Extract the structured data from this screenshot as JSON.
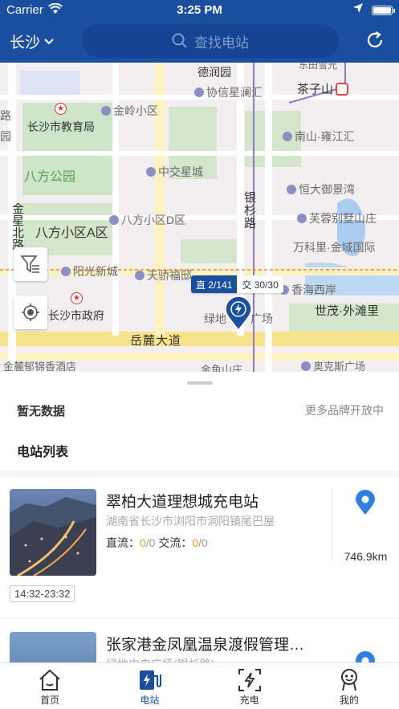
{
  "status_bar": {
    "carrier": "Carrier",
    "time": "3:25 PM"
  },
  "nav": {
    "city": "长沙",
    "search_placeholder": "查找电站"
  },
  "map": {
    "pois": [
      "德润园",
      "茶子山",
      "协信星澜汇",
      "金岭小区",
      "长沙市教育局",
      "南山·雍江汇",
      "八方公园",
      "中交星城",
      "恒大御景湾",
      "八方小区A区",
      "八方小区D区",
      "芙蓉别墅山庄",
      "万科里·金域国际",
      "阳光新城",
      "天骄福邸",
      "香海西岸",
      "长沙市政府",
      "世茂·外滩里",
      "岳麓大道",
      "金麓郁锦香酒店",
      "奥克斯广场",
      "银杉路",
      "绿地",
      "广场",
      "金星北路",
      "路",
      "园",
      "金鱼山庄",
      "东田雪光"
    ],
    "callout": {
      "dc": "直 2/141",
      "ac": "交 30/30"
    }
  },
  "sheet": {
    "no_data": "暂无数据",
    "more_brands": "更多品牌开放中",
    "list_title": "电站列表",
    "stations": [
      {
        "name": "翠柏大道理想城充电站",
        "address": "湖南省长沙市浏阳市洞阳镇尾巴屋",
        "dc_label": "直流：",
        "dc_avail": "0",
        "dc_total": "/0",
        "ac_label": "交流：",
        "ac_avail": "0",
        "ac_total": "/0",
        "distance": "746.9km",
        "hours": "14:32-23:32"
      },
      {
        "name": "张家港金凤凰温泉渡假管理…",
        "address": "绿地中央广场(银杉路)"
      }
    ]
  },
  "tabs": [
    {
      "label": "首页",
      "icon": "home-icon"
    },
    {
      "label": "电站",
      "icon": "station-icon"
    },
    {
      "label": "充电",
      "icon": "charge-icon"
    },
    {
      "label": "我的",
      "icon": "profile-icon"
    }
  ],
  "colors": {
    "brand": "#1a4fa0",
    "accent": "#f29a2e",
    "pin": "#2f7fe0"
  }
}
